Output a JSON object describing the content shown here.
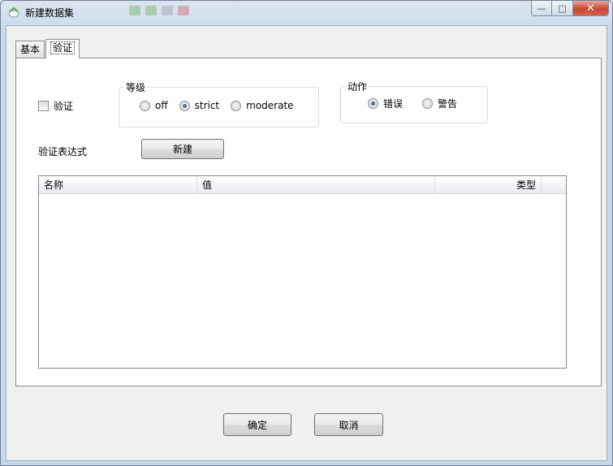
{
  "window": {
    "title": "新建数据集",
    "buttons": {
      "minimize": "—",
      "maximize": "□",
      "close": "✕"
    }
  },
  "tabs": [
    {
      "label": "基本",
      "active": false
    },
    {
      "label": "验证",
      "active": true
    }
  ],
  "validation": {
    "checkbox_label": "验证",
    "checked": false
  },
  "level_group": {
    "legend": "等级",
    "options": [
      {
        "label": "off",
        "selected": false
      },
      {
        "label": "strict",
        "selected": true
      },
      {
        "label": "moderate",
        "selected": false
      }
    ]
  },
  "action_group": {
    "legend": "动作",
    "options": [
      {
        "label": "错误",
        "selected": true
      },
      {
        "label": "警告",
        "selected": false
      }
    ]
  },
  "expression": {
    "label": "验证表达式",
    "new_button": "新建"
  },
  "table": {
    "columns": [
      "名称",
      "值",
      "类型"
    ],
    "rows": []
  },
  "footer": {
    "ok_button": "确定",
    "cancel_button": "取消"
  },
  "colors": {
    "accent": "#1d4a80",
    "close_button": "#c9462f",
    "panel": "#ffffff",
    "client": "#f0f0f0"
  }
}
